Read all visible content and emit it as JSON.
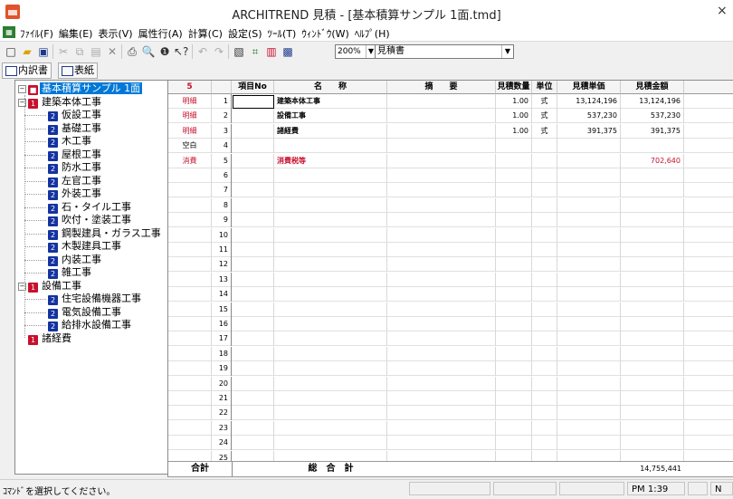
{
  "window": {
    "title": "ARCHITREND 見積 - [基本積算サンプル 1面.tmd]",
    "app_icon_text": "AT見積"
  },
  "menu": [
    "ﾌｧｲﾙ(F)",
    "編集(E)",
    "表示(V)",
    "属性行(A)",
    "計算(C)",
    "設定(S)",
    "ﾂｰﾙ(T)",
    "ｳｨﾝﾄﾞｳ(W)",
    "ﾍﾙﾌﾟ(H)"
  ],
  "toolbar": {
    "zoom_value": "200%",
    "doc_type_value": "見積書"
  },
  "tabs": [
    {
      "label": "内訳書"
    },
    {
      "label": "表紙"
    }
  ],
  "tree": {
    "root": "基本積算サンプル 1面",
    "groups": [
      {
        "badge": "1",
        "label": "建築本体工事",
        "items": [
          "仮設工事",
          "基礎工事",
          "木工事",
          "屋根工事",
          "防水工事",
          "左官工事",
          "外装工事",
          "石・タイル工事",
          "吹付・塗装工事",
          "鋼製建具・ガラス工事",
          "木製建具工事",
          "内装工事",
          "雑工事"
        ]
      },
      {
        "badge": "1",
        "label": "設備工事",
        "items": [
          "住宅設備機器工事",
          "電気設備工事",
          "給排水設備工事"
        ]
      },
      {
        "badge": "1",
        "label": "諸経費",
        "items": []
      }
    ],
    "item_badge": "2"
  },
  "grid": {
    "row_count_header": "5",
    "columns": {
      "item_no": "項目No",
      "name": "名　　称",
      "summary": "摘　　要",
      "qty": "見積数量",
      "unit": "単位",
      "price": "見積単価",
      "amount": "見積金額"
    },
    "rows": [
      {
        "type": "明細",
        "no": "1",
        "name": "建築本体工事",
        "qty": "1.00",
        "unit": "式",
        "price": "13,124,196",
        "amount": "13,124,196"
      },
      {
        "type": "明細",
        "no": "2",
        "name": "設備工事",
        "qty": "1.00",
        "unit": "式",
        "price": "537,230",
        "amount": "537,230"
      },
      {
        "type": "明細",
        "no": "3",
        "name": "諸経費",
        "qty": "1.00",
        "unit": "式",
        "price": "391,375",
        "amount": "391,375"
      },
      {
        "type": "空白",
        "no": "4",
        "name": "",
        "qty": "",
        "unit": "",
        "price": "",
        "amount": ""
      },
      {
        "type": "消費",
        "no": "5",
        "name": "消費税等",
        "qty": "",
        "unit": "",
        "price": "",
        "amount": "702,640"
      },
      {
        "type": "",
        "no": "6"
      },
      {
        "type": "",
        "no": "7"
      },
      {
        "type": "",
        "no": "8"
      },
      {
        "type": "",
        "no": "9"
      },
      {
        "type": "",
        "no": "10"
      },
      {
        "type": "",
        "no": "11"
      },
      {
        "type": "",
        "no": "12"
      },
      {
        "type": "",
        "no": "13"
      },
      {
        "type": "",
        "no": "14"
      },
      {
        "type": "",
        "no": "15"
      },
      {
        "type": "",
        "no": "16"
      },
      {
        "type": "",
        "no": "17"
      },
      {
        "type": "",
        "no": "18"
      },
      {
        "type": "",
        "no": "19"
      },
      {
        "type": "",
        "no": "20"
      },
      {
        "type": "",
        "no": "21"
      },
      {
        "type": "",
        "no": "22"
      },
      {
        "type": "",
        "no": "23"
      },
      {
        "type": "",
        "no": "24"
      },
      {
        "type": "",
        "no": "25"
      }
    ],
    "total": {
      "label": "合計",
      "grand_label": "総　合　計",
      "amount": "14,755,441"
    }
  },
  "status": {
    "message": "ｺﾏﾝﾄﾞを選択してください。",
    "time": "PM 1:39",
    "mode": "N"
  },
  "colors": {
    "accent_red": "#c8102e",
    "badge_blue": "#1433a0",
    "selection": "#0078d7"
  }
}
